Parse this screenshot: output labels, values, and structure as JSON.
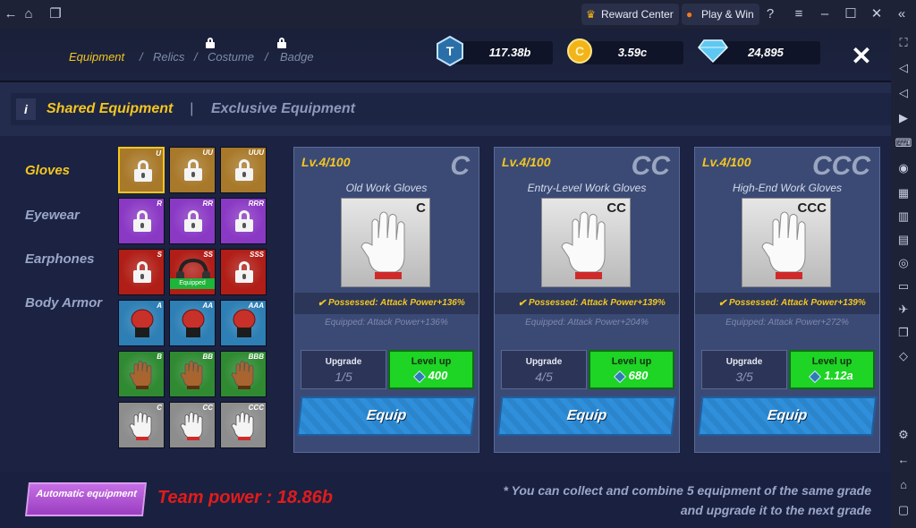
{
  "titlebar": {
    "reward_center": "Reward Center",
    "play_win": "Play & Win"
  },
  "tabs": {
    "equipment": "Equipment",
    "relics": "Relics",
    "costume": "Costume",
    "badge": "Badge"
  },
  "currencies": {
    "tcoin": "117.38b",
    "gold": "3.59c",
    "diamond": "24,895"
  },
  "subtabs": {
    "info": "i",
    "shared": "Shared Equipment",
    "divider": "|",
    "exclusive": "Exclusive Equipment"
  },
  "categories": [
    "Gloves",
    "Eyewear",
    "Earphones",
    "Body Armor"
  ],
  "grid": {
    "rows": [
      {
        "grades": [
          "U",
          "UU",
          "UUU"
        ],
        "color": "#a8792a"
      },
      {
        "grades": [
          "R",
          "RR",
          "RRR"
        ],
        "color": "#8a39c4"
      },
      {
        "grades": [
          "S",
          "SS",
          "SSS"
        ],
        "color": "#b01e17"
      },
      {
        "grades": [
          "A",
          "AA",
          "AAA"
        ],
        "color": "#2d7fb5"
      },
      {
        "grades": [
          "B",
          "BB",
          "BBB"
        ],
        "color": "#2f8a32"
      },
      {
        "grades": [
          "C",
          "CC",
          "CCC"
        ],
        "color": "#8d8d8d"
      }
    ],
    "equipped_label": "Equipped"
  },
  "cards": [
    {
      "level": "Lv.4/100",
      "grade": "C",
      "name": "Old Work Gloves",
      "possessed": "Possessed: Attack Power+136%",
      "equipped": "Equipped: Attack Power+136%",
      "upgrade_label": "Upgrade",
      "upgrade_value": "1/5",
      "levelup_label": "Level up",
      "levelup_cost": "400",
      "equip_label": "Equip"
    },
    {
      "level": "Lv.4/100",
      "grade": "CC",
      "name": "Entry-Level Work Gloves",
      "possessed": "Possessed: Attack Power+139%",
      "equipped": "Equipped: Attack Power+204%",
      "upgrade_label": "Upgrade",
      "upgrade_value": "4/5",
      "levelup_label": "Level up",
      "levelup_cost": "680",
      "equip_label": "Equip"
    },
    {
      "level": "Lv.4/100",
      "grade": "CCC",
      "name": "High-End Work Gloves",
      "possessed": "Possessed: Attack Power+139%",
      "equipped": "Equipped: Attack Power+272%",
      "upgrade_label": "Upgrade",
      "upgrade_value": "3/5",
      "levelup_label": "Level up",
      "levelup_cost": "1.12a",
      "equip_label": "Equip"
    }
  ],
  "bottom": {
    "auto_equipment": "Automatic equipment",
    "team_power": "Team power : 18.86b",
    "note": "* You can collect and combine 5 equipment of the same grade and upgrade it to the next grade"
  },
  "colors": {
    "accent_yellow": "#f4c61f",
    "levelup_green": "#1ed424",
    "equip_blue": "#2f8fda",
    "team_power_red": "#e21b1b"
  }
}
